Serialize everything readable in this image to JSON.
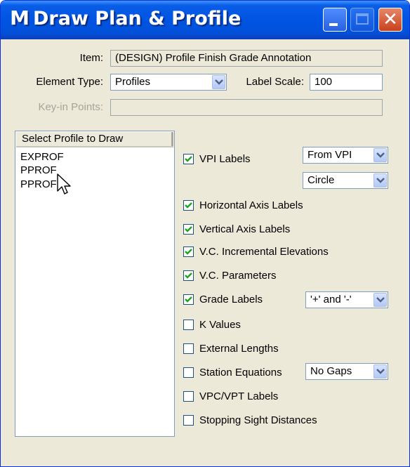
{
  "window": {
    "title": "Draw Plan & Profile",
    "icon": "app-logo-icon",
    "app_glyph": "M",
    "close_glyph": "✕"
  },
  "form": {
    "item_label": "Item:",
    "item_value": "(DESIGN) Profile Finish Grade Annotation",
    "element_type_label": "Element Type:",
    "element_type_value": "Profiles",
    "label_scale_label": "Label Scale:",
    "label_scale_value": "100",
    "keyin_label": "Key-in Points:",
    "keyin_value": ""
  },
  "profile_list": {
    "header": "Select Profile to Draw",
    "items": [
      "EXPROF",
      "PPROF",
      "PPROF"
    ]
  },
  "options": [
    {
      "label": "VPI Labels",
      "checked": true
    },
    {
      "label": "Horizontal Axis Labels",
      "checked": true
    },
    {
      "label": "Vertical Axis Labels",
      "checked": true
    },
    {
      "label": "V.C. Incremental Elevations",
      "checked": true
    },
    {
      "label": "V.C. Parameters",
      "checked": true
    },
    {
      "label": "Grade Labels",
      "checked": true
    },
    {
      "label": "K Values",
      "checked": false
    },
    {
      "label": "External Lengths",
      "checked": false
    },
    {
      "label": "Station Equations",
      "checked": false
    },
    {
      "label": "VPC/VPT Labels",
      "checked": false
    },
    {
      "label": "Stopping Sight Distances",
      "checked": false
    }
  ],
  "dropdowns": {
    "vpi_position": "From VPI",
    "vpi_shape": "Circle",
    "grade_sign": "'+' and '-'",
    "station_gaps": "No Gaps"
  },
  "colors": {
    "titlebar": "#0054e3",
    "dialog_bg": "#ece9d8",
    "checkmark": "#21a121"
  }
}
